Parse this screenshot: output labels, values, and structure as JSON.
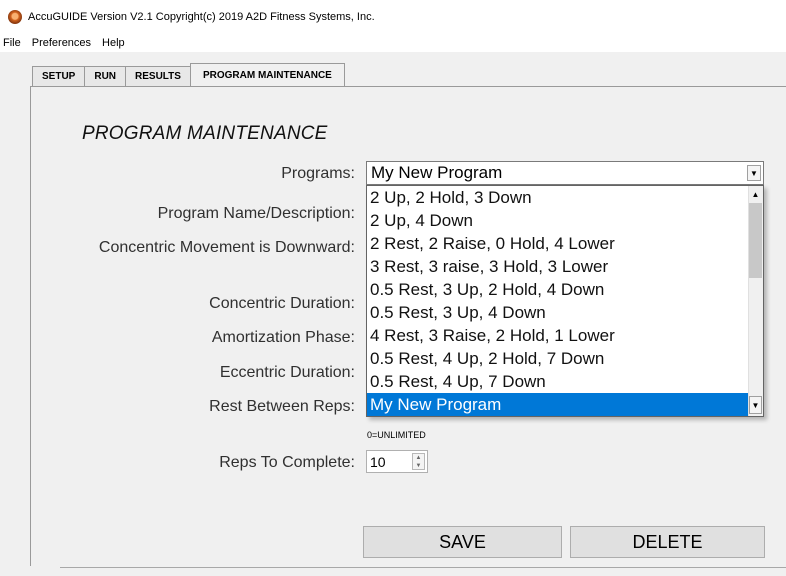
{
  "window": {
    "title": "AccuGUIDE Version V2.1 Copyright(c) 2019 A2D Fitness Systems, Inc.",
    "icon": "app-logo-icon"
  },
  "menu": [
    "File",
    "Preferences",
    "Help"
  ],
  "tabs": [
    {
      "label": "SETUP",
      "active": false
    },
    {
      "label": "RUN",
      "active": false
    },
    {
      "label": "RESULTS",
      "active": false
    },
    {
      "label": "PROGRAM MAINTENANCE",
      "active": true
    }
  ],
  "main": {
    "heading": "PROGRAM MAINTENANCE",
    "labels": {
      "programs": "Programs:",
      "name": "Program Name/Description:",
      "concentric_down": "Concentric Movement is Downward:",
      "concentric_duration": "Concentric Duration:",
      "amortization": "Amortization Phase:",
      "eccentric_duration": "Eccentric Duration:",
      "rest": "Rest Between Reps:",
      "reps": "Reps To Complete:"
    },
    "programs_selected": "My New Program",
    "program_options": [
      "2 Up, 2 Hold, 3 Down",
      "2 Up, 4 Down",
      "2 Rest, 2 Raise, 0 Hold, 4 Lower",
      "3 Rest, 3 raise, 3 Hold, 3 Lower",
      "0.5 Rest, 3 Up, 2 Hold, 4 Down",
      "0.5 Rest, 3 Up, 4 Down",
      "4 Rest, 3 Raise, 2 Hold, 1 Lower",
      "0.5 Rest, 4 Up, 2 Hold, 7 Down",
      "0.5 Rest, 4 Up, 7 Down",
      "My New Program"
    ],
    "unlimited_note": "0=UNLIMITED",
    "reps_value": "10",
    "save_label": "SAVE",
    "delete_label": "DELETE"
  },
  "colors": {
    "selection": "#0078d7",
    "window_bg": "#f0f0f0",
    "button_bg": "#e0e0e0"
  }
}
